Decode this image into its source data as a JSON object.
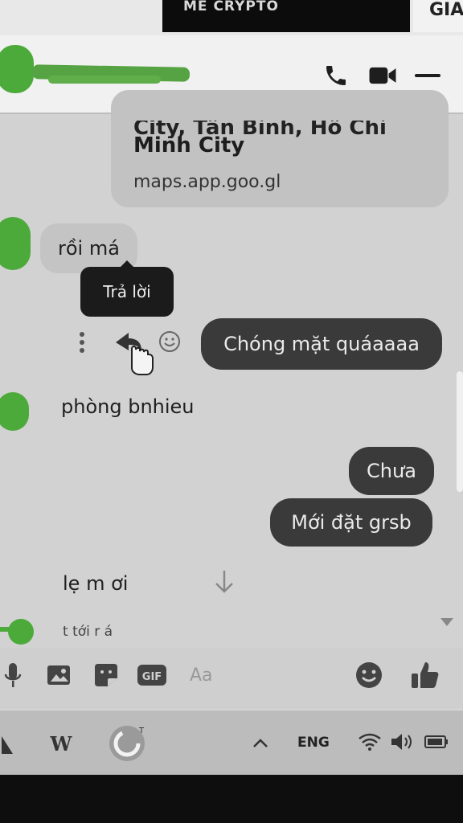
{
  "browser": {
    "tab_left_text": "ME CRYPTO",
    "tab_right_text": "GIA"
  },
  "chat": {
    "contact_name_redacted": true
  },
  "messages": {
    "link_card": {
      "line1": "City, Tân Bình, Hồ Chí",
      "line2": "Minh City",
      "url": "maps.app.goo.gl"
    },
    "incoming_1": "rồi má",
    "tooltip": "Trả lời",
    "outgoing_1": "Chóng mặt quáaaaa",
    "incoming_2": "phòng bnhieu",
    "outgoing_2": "Chưa",
    "outgoing_3": "Mới đặt grsb",
    "incoming_3": "lẹ m ơi",
    "incoming_4_partial": "t tới r á"
  },
  "composer": {
    "placeholder": "Aa"
  },
  "taskbar": {
    "language": "ENG"
  },
  "colors": {
    "avatar_green": "#4caa3a",
    "outgoing_bubble": "#3a3a3a",
    "incoming_bubble": "#c4c4c4"
  },
  "icons": {
    "header": [
      "phone-icon",
      "video-call-icon",
      "minimize-icon"
    ],
    "composer": [
      "microphone-icon",
      "image-icon",
      "sticker-icon",
      "gif-icon",
      "emoji-icon",
      "thumbs-up-icon"
    ],
    "message_actions": [
      "more-options-icon",
      "reply-icon",
      "react-emoji-icon"
    ]
  }
}
